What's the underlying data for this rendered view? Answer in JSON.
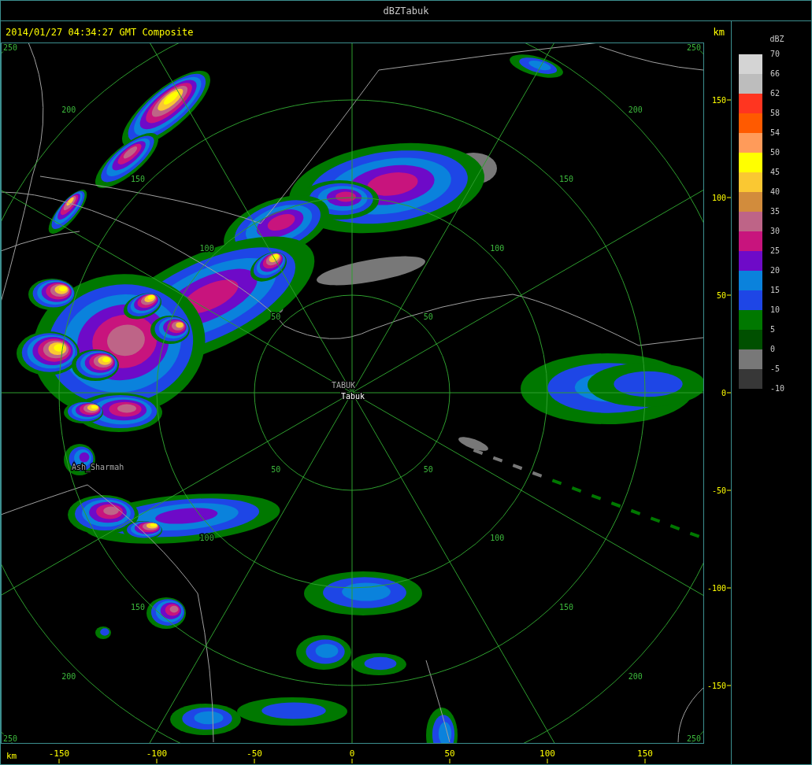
{
  "window": {
    "title": "dBZTabuk"
  },
  "header": {
    "timestamp": "2014/01/27 04:34:27 GMT Composite",
    "unit": "km"
  },
  "radar_plot": {
    "range_rings": [
      {
        "labels": [
          "50",
          "50",
          "50",
          "50"
        ]
      },
      {
        "labels": [
          "100",
          "100",
          "100",
          "100"
        ]
      },
      {
        "labels": [
          "150",
          "150",
          "150",
          "150"
        ]
      },
      {
        "labels": [
          "200",
          "200",
          "200",
          "200"
        ]
      },
      {
        "labels": [
          "250",
          "250",
          "250",
          "250"
        ]
      }
    ],
    "places": [
      {
        "name": "TABUK",
        "kind": "station"
      },
      {
        "name": "Tabuk",
        "kind": "city"
      },
      {
        "name": "Ash_Sharmah",
        "kind": "station"
      }
    ],
    "y_axis": {
      "ticks": [
        "150",
        "100",
        "50",
        "0",
        "-50",
        "-100",
        "-150"
      ]
    },
    "x_axis": {
      "unit": "km",
      "ticks": [
        "-150",
        "-100",
        "-50",
        "0",
        "50",
        "100",
        "150"
      ]
    }
  },
  "legend": {
    "title": "dBZ",
    "items": [
      {
        "label": "70",
        "color": "#d4d4d4"
      },
      {
        "label": "66",
        "color": "#bdbdbd"
      },
      {
        "label": "62",
        "color": "#ff3520"
      },
      {
        "label": "58",
        "color": "#ff5a00"
      },
      {
        "label": "54",
        "color": "#ff9b5a"
      },
      {
        "label": "50",
        "color": "#ffff00"
      },
      {
        "label": "45",
        "color": "#fac832"
      },
      {
        "label": "40",
        "color": "#d28c3c"
      },
      {
        "label": "35",
        "color": "#be6487"
      },
      {
        "label": "30",
        "color": "#c8147d"
      },
      {
        "label": "25",
        "color": "#6e0ac8"
      },
      {
        "label": "20",
        "color": "#0a82dc"
      },
      {
        "label": "15",
        "color": "#1e46e6"
      },
      {
        "label": "10",
        "color": "#007800"
      },
      {
        "label": "5",
        "color": "#005000"
      },
      {
        "label": "0",
        "color": "#787878"
      },
      {
        "label": "-5",
        "color": "#373737"
      }
    ],
    "bottom_label": "-10"
  }
}
